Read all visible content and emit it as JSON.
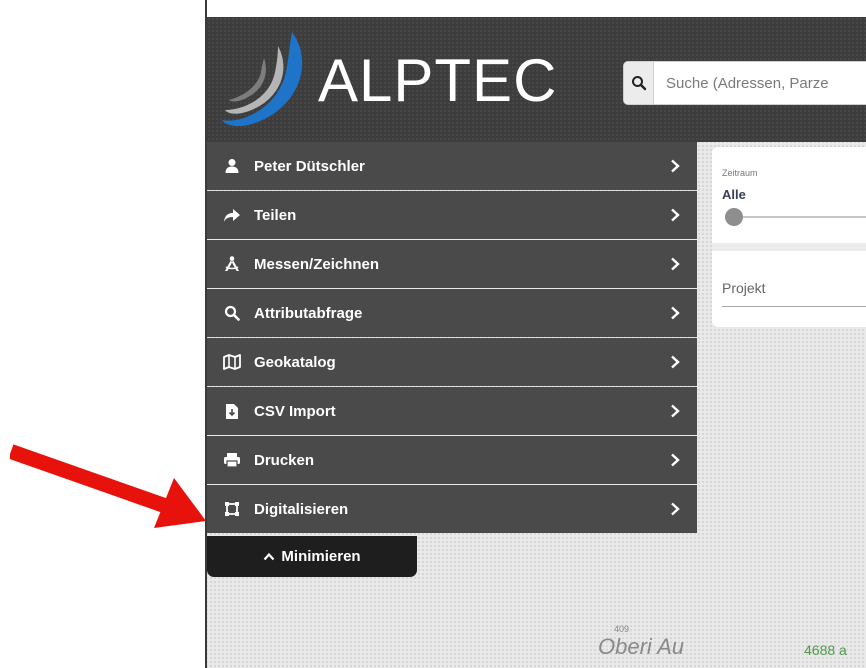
{
  "brand": {
    "name": "ALPTEC",
    "colors": {
      "accent": "#1e74c8",
      "header": "#3d3d3d"
    }
  },
  "search": {
    "placeholder": "Suche (Adressen, Parze",
    "icon": "search-icon"
  },
  "filters": {
    "zeitraum_label": "Zeitraum",
    "zeitraum_value": "Alle",
    "projekt_label": "Projekt"
  },
  "menu": {
    "items": [
      {
        "label": "Peter Dütschler",
        "icon": "user-icon"
      },
      {
        "label": "Teilen",
        "icon": "share-icon"
      },
      {
        "label": "Messen/Zeichnen",
        "icon": "measure-draw-icon"
      },
      {
        "label": "Attributabfrage",
        "icon": "search-icon"
      },
      {
        "label": "Geokatalog",
        "icon": "map-icon"
      },
      {
        "label": "CSV Import",
        "icon": "file-import-icon"
      },
      {
        "label": "Drucken",
        "icon": "print-icon"
      },
      {
        "label": "Digitalisieren",
        "icon": "vector-square-icon"
      }
    ],
    "minimize_label": "Minimieren"
  },
  "map": {
    "place_label": "Oberi Au",
    "small_number": "409",
    "coordinate_fragment": "4688 a"
  },
  "annotation": {
    "arrow_color": "#e8120c"
  }
}
